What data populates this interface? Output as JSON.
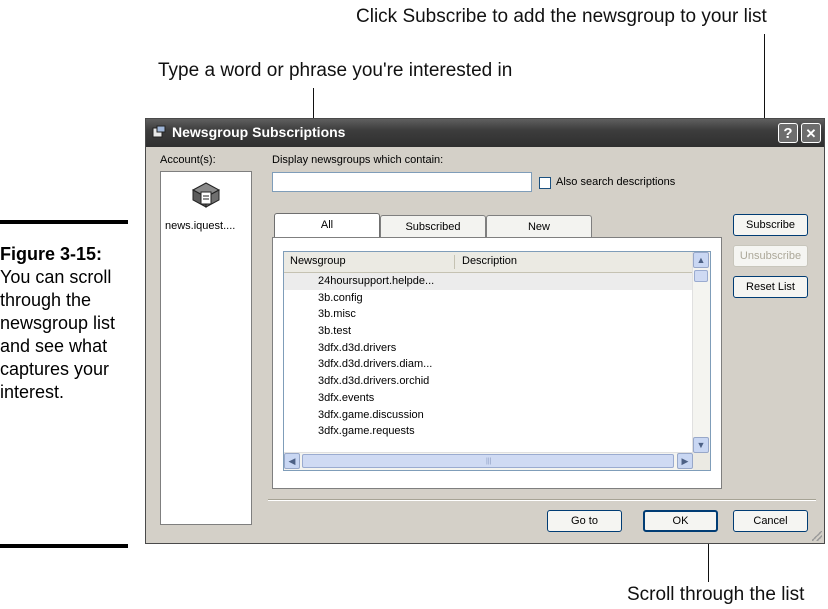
{
  "callouts": {
    "subscribe_note": "Click Subscribe to add the newsgroup to your list",
    "type_note": "Type a word or phrase you're interested in",
    "scroll_note": "Scroll through the list"
  },
  "figure": {
    "number": "Figure 3-15:",
    "caption": "You can scroll through the newsgroup list and see what captures your interest."
  },
  "window": {
    "title": "Newsgroup Subscriptions",
    "help_button": "?",
    "close_button": "✕"
  },
  "accounts": {
    "label": "Account(s):",
    "items": [
      {
        "name": "news.iquest...."
      }
    ]
  },
  "filter": {
    "label": "Display newsgroups which contain:",
    "value": "",
    "also_search_label": "Also search descriptions"
  },
  "tabs": [
    {
      "label": "All"
    },
    {
      "label": "Subscribed"
    },
    {
      "label": "New"
    }
  ],
  "list": {
    "columns": [
      "Newsgroup",
      "Description"
    ],
    "rows": [
      "24hoursupport.helpde...",
      "3b.config",
      "3b.misc",
      "3b.test",
      "3dfx.d3d.drivers",
      "3dfx.d3d.drivers.diam...",
      "3dfx.d3d.drivers.orchid",
      "3dfx.events",
      "3dfx.game.discussion",
      "3dfx.game.requests"
    ]
  },
  "buttons": {
    "subscribe": "Subscribe",
    "unsubscribe": "Unsubscribe",
    "reset_list": "Reset List",
    "go_to": "Go to",
    "ok": "OK",
    "cancel": "Cancel"
  }
}
